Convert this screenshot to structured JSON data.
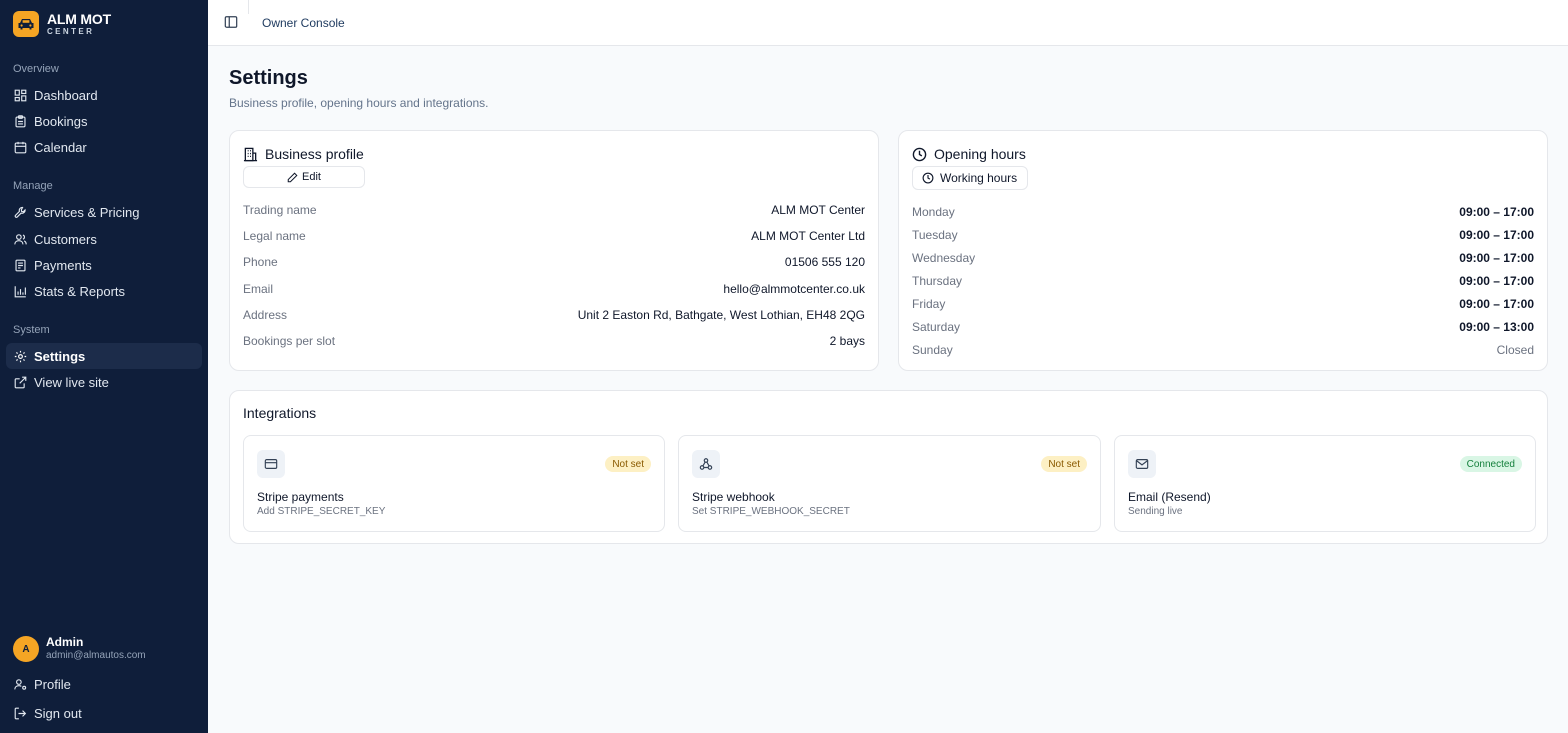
{
  "brand": {
    "title": "ALM MOT",
    "subtitle": "CENTER",
    "accent": "#f5a524"
  },
  "sidebar": {
    "sections": [
      {
        "label": "Overview",
        "items": [
          {
            "label": "Dashboard",
            "icon": "grid-icon"
          },
          {
            "label": "Bookings",
            "icon": "clipboard-icon"
          },
          {
            "label": "Calendar",
            "icon": "calendar-icon"
          }
        ]
      },
      {
        "label": "Manage",
        "items": [
          {
            "label": "Services & Pricing",
            "icon": "wrench-icon"
          },
          {
            "label": "Customers",
            "icon": "users-icon"
          },
          {
            "label": "Payments",
            "icon": "receipt-icon"
          },
          {
            "label": "Stats & Reports",
            "icon": "bar-chart-icon"
          }
        ]
      },
      {
        "label": "System",
        "items": [
          {
            "label": "Settings",
            "icon": "gear-icon",
            "active": true
          },
          {
            "label": "View live site",
            "icon": "external-link-icon"
          }
        ]
      }
    ],
    "user": {
      "initial": "A",
      "name": "Admin",
      "email": "admin@almautos.com"
    },
    "footer": [
      {
        "label": "Profile",
        "icon": "user-cog-icon"
      },
      {
        "label": "Sign out",
        "icon": "sign-out-icon"
      }
    ]
  },
  "topbar": {
    "title": "Owner Console"
  },
  "page": {
    "title": "Settings",
    "subtitle": "Business profile, opening hours and integrations."
  },
  "business_profile": {
    "title": "Business profile",
    "edit_label": "Edit",
    "rows": [
      {
        "label": "Trading name",
        "value": "ALM MOT Center"
      },
      {
        "label": "Legal name",
        "value": "ALM MOT Center Ltd"
      },
      {
        "label": "Phone",
        "value": "01506 555 120"
      },
      {
        "label": "Email",
        "value": "hello@almmotcenter.co.uk"
      },
      {
        "label": "Address",
        "value": "Unit 2 Easton Rd, Bathgate, West Lothian, EH48 2QG"
      },
      {
        "label": "Bookings per slot",
        "value": "2 bays"
      }
    ]
  },
  "opening_hours": {
    "title": "Opening hours",
    "button_label": "Working hours",
    "days": [
      {
        "day": "Monday",
        "hours": "09:00 – 17:00"
      },
      {
        "day": "Tuesday",
        "hours": "09:00 – 17:00"
      },
      {
        "day": "Wednesday",
        "hours": "09:00 – 17:00"
      },
      {
        "day": "Thursday",
        "hours": "09:00 – 17:00"
      },
      {
        "day": "Friday",
        "hours": "09:00 – 17:00"
      },
      {
        "day": "Saturday",
        "hours": "09:00 – 13:00"
      },
      {
        "day": "Sunday",
        "hours": "Closed"
      }
    ]
  },
  "integrations": {
    "title": "Integrations",
    "items": [
      {
        "name": "Stripe payments",
        "desc": "Add STRIPE_SECRET_KEY",
        "status": "Not set",
        "state": "warn",
        "icon": "credit-card-icon"
      },
      {
        "name": "Stripe webhook",
        "desc": "Set STRIPE_WEBHOOK_SECRET",
        "status": "Not set",
        "state": "warn",
        "icon": "webhook-icon"
      },
      {
        "name": "Email (Resend)",
        "desc": "Sending live",
        "status": "Connected",
        "state": "ok",
        "icon": "mail-icon"
      }
    ]
  }
}
